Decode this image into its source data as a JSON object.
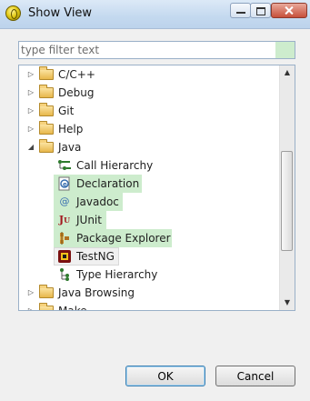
{
  "window": {
    "title": "Show View",
    "icon": "eclipse-icon"
  },
  "filter": {
    "placeholder": "type filter text",
    "value": ""
  },
  "tree": {
    "folders_top": [
      {
        "label": "C/C++",
        "expanded": false
      },
      {
        "label": "Debug",
        "expanded": false
      },
      {
        "label": "Git",
        "expanded": false
      },
      {
        "label": "Help",
        "expanded": false
      },
      {
        "label": "Java",
        "expanded": true
      }
    ],
    "java_children": [
      {
        "label": "Call Hierarchy",
        "icon": "call-hierarchy-icon",
        "highlighted": false
      },
      {
        "label": "Declaration",
        "icon": "declaration-icon",
        "highlighted": true
      },
      {
        "label": "Javadoc",
        "icon": "javadoc-icon",
        "highlighted": true
      },
      {
        "label": "JUnit",
        "icon": "junit-icon",
        "highlighted": true
      },
      {
        "label": "Package Explorer",
        "icon": "package-explorer-icon",
        "highlighted": true
      },
      {
        "label": "TestNG",
        "icon": "testng-icon",
        "highlighted": false,
        "selected": true
      },
      {
        "label": "Type Hierarchy",
        "icon": "type-hierarchy-icon",
        "highlighted": false
      }
    ],
    "folders_bottom": [
      {
        "label": "Java Browsing",
        "expanded": false
      },
      {
        "label": "Make",
        "expanded": false
      }
    ]
  },
  "buttons": {
    "ok": "OK",
    "cancel": "Cancel"
  },
  "colors": {
    "highlight": "#cdeccd",
    "titlebar": "#c4d9ef",
    "dialog": "#f0f0f0"
  }
}
